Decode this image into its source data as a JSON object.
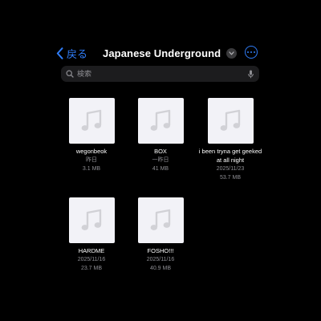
{
  "nav": {
    "back_label": "戻る",
    "title": "Japanese Underground"
  },
  "search": {
    "placeholder": "検索"
  },
  "files": [
    {
      "name": "wegonbeok",
      "date": "昨日",
      "size": "3.1 MB"
    },
    {
      "name": "BOX",
      "date": "一昨日",
      "size": "41 MB"
    },
    {
      "name": "i been tryna get geeked at all night",
      "date": "2025/11/23",
      "size": "53.7 MB"
    },
    {
      "name": "HARDME",
      "date": "2025/11/16",
      "size": "23.7 MB"
    },
    {
      "name": "FOSHO!!!",
      "date": "2025/11/16",
      "size": "40.9 MB"
    }
  ],
  "colors": {
    "background": "#000000",
    "accent": "#2f7cf6",
    "secondary_text": "#8e8e93",
    "search_field": "#1c1c1e",
    "thumbnail": "#f2f2f7",
    "music_note": "#d1d1d6"
  },
  "icons": {
    "back": "chevron-left-icon",
    "title_menu": "chevron-down-icon",
    "more": "ellipsis-circle-icon",
    "search": "magnifying-glass-icon",
    "mic": "microphone-icon",
    "file_thumbnail": "music-note-icon"
  }
}
